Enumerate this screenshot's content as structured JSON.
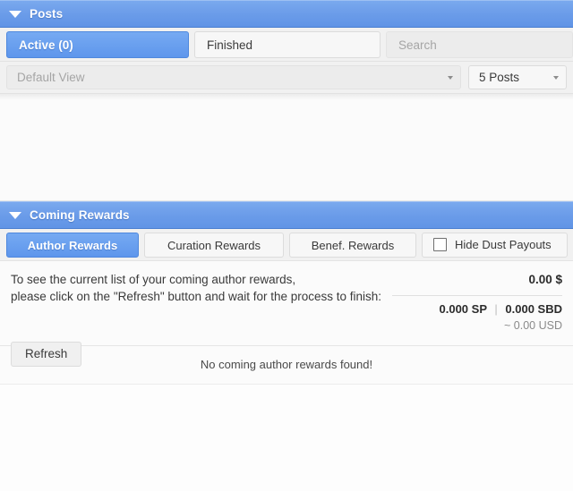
{
  "posts_panel": {
    "header": {
      "title": "Posts",
      "collapse_icon": "triangle-down-icon"
    },
    "tabs": [
      {
        "label": "Active (0)",
        "active": true
      },
      {
        "label": "Finished",
        "active": false
      }
    ],
    "search": {
      "placeholder": "Search",
      "value": ""
    },
    "view_select": {
      "value": "Default View",
      "caret_icon": "caret-down-icon"
    },
    "count_select": {
      "value": "5 Posts",
      "caret_icon": "caret-down-icon"
    }
  },
  "rewards_panel": {
    "header": {
      "title": "Coming Rewards",
      "collapse_icon": "triangle-down-icon"
    },
    "tabs": [
      {
        "label": "Author Rewards",
        "active": true
      },
      {
        "label": "Curation Rewards",
        "active": false
      },
      {
        "label": "Benef. Rewards",
        "active": false
      }
    ],
    "hide_dust": {
      "label": "Hide Dust Payouts",
      "checked": false,
      "checkbox_icon": "checkbox-unchecked-icon"
    },
    "description_line1": "To see the current list of your coming author rewards,",
    "description_line2": "please click on the \"Refresh\" button and wait for the process to finish:",
    "refresh_button": "Refresh",
    "totals": {
      "amount": "0.00 $",
      "sp": "0.000 SP",
      "separator": "|",
      "sbd": "0.000 SBD",
      "usd": "~ 0.00 USD"
    },
    "empty_message": "No coming author rewards found!"
  },
  "colors": {
    "header_blue": "#6b9ce9",
    "tab_active_blue": "#5e96ec",
    "panel_bg": "#f1f1f1",
    "content_bg": "#fbfbfb"
  }
}
